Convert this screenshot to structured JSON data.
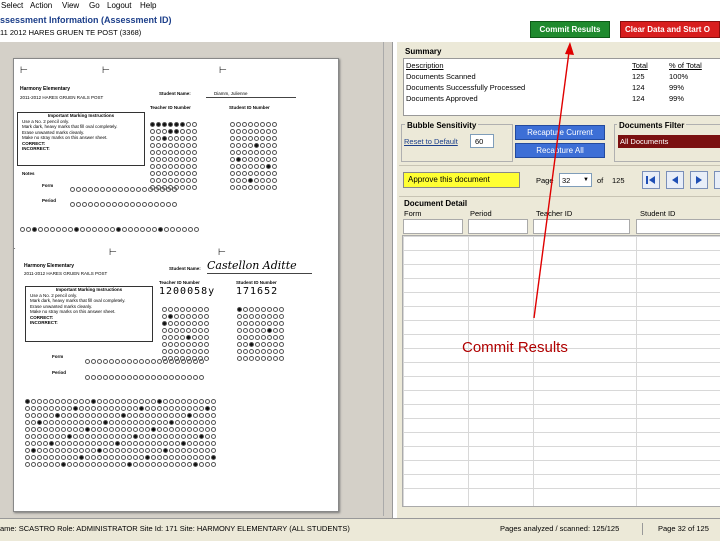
{
  "menu": [
    "Select",
    "Action",
    "View",
    "Go",
    "Logout",
    "Help"
  ],
  "title": "ssessment Information (Assessment ID)",
  "subtitle": "11 2012 HARES GRUEN TE POST (3368)",
  "buttons": {
    "commit": "Commit Results",
    "clear": "Clear Data and Start O",
    "recapture_current": "Recapture Current",
    "recapture_all": "Recapture All",
    "approve": "Approve this document"
  },
  "summary": {
    "title": "Summary",
    "headers": [
      "Description",
      "Total",
      "% of Total"
    ],
    "rows": [
      [
        "Documents Scanned",
        "125",
        "100%"
      ],
      [
        "Documents Successfully Processed",
        "124",
        "99%"
      ],
      [
        "Documents Approved",
        "124",
        "99%"
      ]
    ]
  },
  "bubble": {
    "title": "Bubble Sensitivity",
    "reset_label": "Reset to Default",
    "value": "60"
  },
  "filter": {
    "title": "Documents Filter",
    "value": "All Documents"
  },
  "pager": {
    "page_label": "Page",
    "page_value": "32",
    "of_label": "of",
    "total": "125"
  },
  "detail": {
    "title": "Document Detail",
    "headers": [
      "Form",
      "Period",
      "Teacher ID",
      "Student ID"
    ]
  },
  "annotation": "Commit Results",
  "sheet1": {
    "school": "Harmony Elementary",
    "sub": "2011-2012 HARES GRUEN RAILS POST",
    "student_name_label": "Student Name:",
    "student_name": "Diamm, Julienne",
    "teacher_id_label": "Teacher ID Number",
    "student_id_label": "Student ID Number",
    "instructions_title": "Important Marking Instructions",
    "instructions": [
      "Use a No. 2 pencil only.",
      "Mark dark, heavy marks that fill oval completely.",
      "Erase unwanted marks cleanly.",
      "Make no stray marks on this answer sheet."
    ],
    "correct": "CORRECT:",
    "incorrect": "INCORRECT:",
    "notes": "Notes",
    "form": "Form",
    "period": "Period"
  },
  "sheet2": {
    "school": "Harmony Elementary",
    "sub": "2011-2012 HARES GRUEN RAILS POST",
    "student_name_label": "Student Name:",
    "handwriting": "Castellon Aditte",
    "teacher_id_label": "Teacher ID Number",
    "student_id_label": "Student ID Number",
    "teacher_id_written": "1200058y",
    "student_id_written": "171652",
    "instructions_title": "Important Marking Instructions",
    "instructions": [
      "Use a No. 2 pencil only.",
      "Mark dark, heavy marks that fill oval completely.",
      "Erase unwanted marks cleanly.",
      "Make no stray marks on this answer sheet."
    ],
    "correct": "CORRECT:",
    "incorrect": "INCORRECT:",
    "form": "Form",
    "period": "Period"
  },
  "status": {
    "left": "ame: SCASTRO  Role: ADMINISTRATOR  Site Id: 171  Site: HARMONY ELEMENTARY (ALL STUDENTS)",
    "middle": "Pages analyzed / scanned: 125/125",
    "right": "Page 32 of 125"
  },
  "colors": {
    "commit_bg": "#1f8a2e",
    "clear_bg": "#d81e1e",
    "recapture_bg": "#3d6fd6",
    "filter_bg": "#7a1010",
    "approve_bg": "#ffff33",
    "arrow": "#e00000"
  }
}
